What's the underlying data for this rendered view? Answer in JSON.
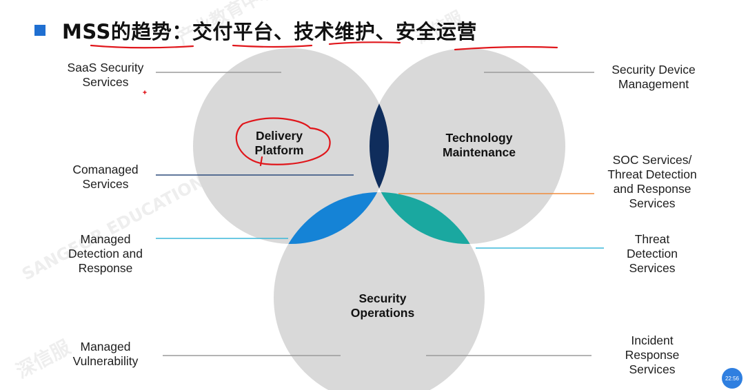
{
  "title": "MSS的趋势：交付平台、技术维护、安全运营",
  "circles": {
    "delivery": "Delivery\nPlatform",
    "technology": "Technology\nMaintenance",
    "security": "Security\nOperations"
  },
  "labels": {
    "saas": "SaaS Security\nServices",
    "comanaged": "Comanaged\nServices",
    "mdr": "Managed\nDetection and\nResponse",
    "vulnerability": "Managed\nVulnerability",
    "device": "Security Device\nManagement",
    "soc": "SOC Services/\nThreat Detection\nand Response\nServices",
    "threat": "Threat\nDetection\nServices",
    "incident": "Incident\nResponse\nServices"
  },
  "watermarks": [
    "深信服",
    "产业教育中心",
    "SANGFOR EDUCATION CENTER"
  ],
  "clock": "22:56",
  "colors": {
    "circle": "#d9d9d9",
    "navy": "#0f2d5c",
    "orange": "#f26b10",
    "blue": "#1583d6",
    "teal": "#1aa8a0",
    "line_gray": "#9a9a9a",
    "line_navy": "#2c4a7c",
    "line_orange": "#f08a3a",
    "line_cyan": "#3ab7d8",
    "annotation_red": "#e0161b",
    "bullet": "#1f6fd1"
  }
}
